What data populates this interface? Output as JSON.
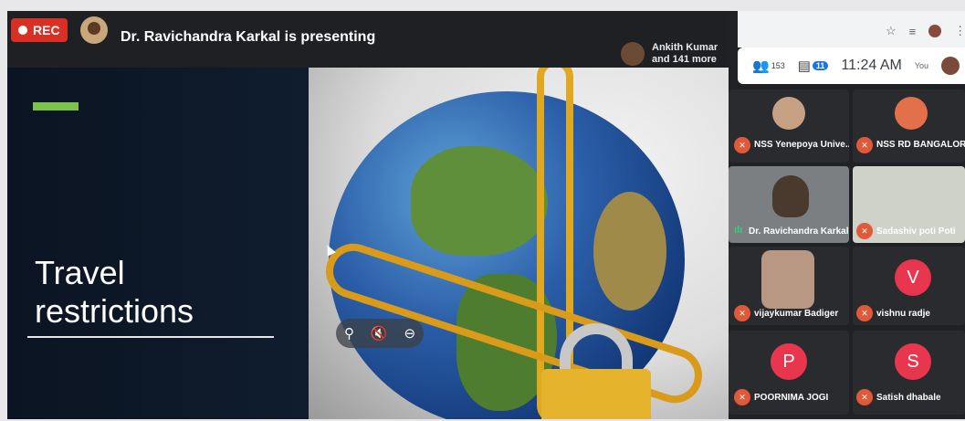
{
  "recording": {
    "label": "REC"
  },
  "header": {
    "presenting_text": "Dr. Ravichandra Karkal is presenting",
    "viewers_line1": "Ankith Kumar",
    "viewers_line2": "and 141 more"
  },
  "slide": {
    "title_line1": "Travel",
    "title_line2": "restrictions"
  },
  "hover_tools": {
    "pin": "⚲",
    "mute": "🔇",
    "remove": "⊖"
  },
  "toolbar": {
    "people_count": "153",
    "chat_count": "11",
    "time": "11:24 AM",
    "you_label": "You"
  },
  "participants": [
    {
      "name": "NSS Yenepoya Unive...",
      "kind": "photo",
      "muted": true
    },
    {
      "name": "NSS RD BANGALORE",
      "kind": "photo",
      "muted": true
    },
    {
      "name": "Dr. Ravichandra Karkal",
      "kind": "video",
      "muted": false
    },
    {
      "name": "Sadashiv poti Poti",
      "kind": "video",
      "muted": true
    },
    {
      "name": "vijaykumar Badiger",
      "kind": "video",
      "muted": true
    },
    {
      "name": "vishnu radje",
      "kind": "letter",
      "letter": "V",
      "muted": true
    },
    {
      "name": "POORNIMA JOGI",
      "kind": "letter",
      "letter": "P",
      "muted": true
    },
    {
      "name": "Satish dhabale",
      "kind": "letter",
      "letter": "S",
      "muted": true
    }
  ],
  "colors": {
    "letter_avatar": "#e8364f",
    "muted_badge": "#e05a3a",
    "rec": "#d93025",
    "accent_green": "#7cc24a"
  }
}
